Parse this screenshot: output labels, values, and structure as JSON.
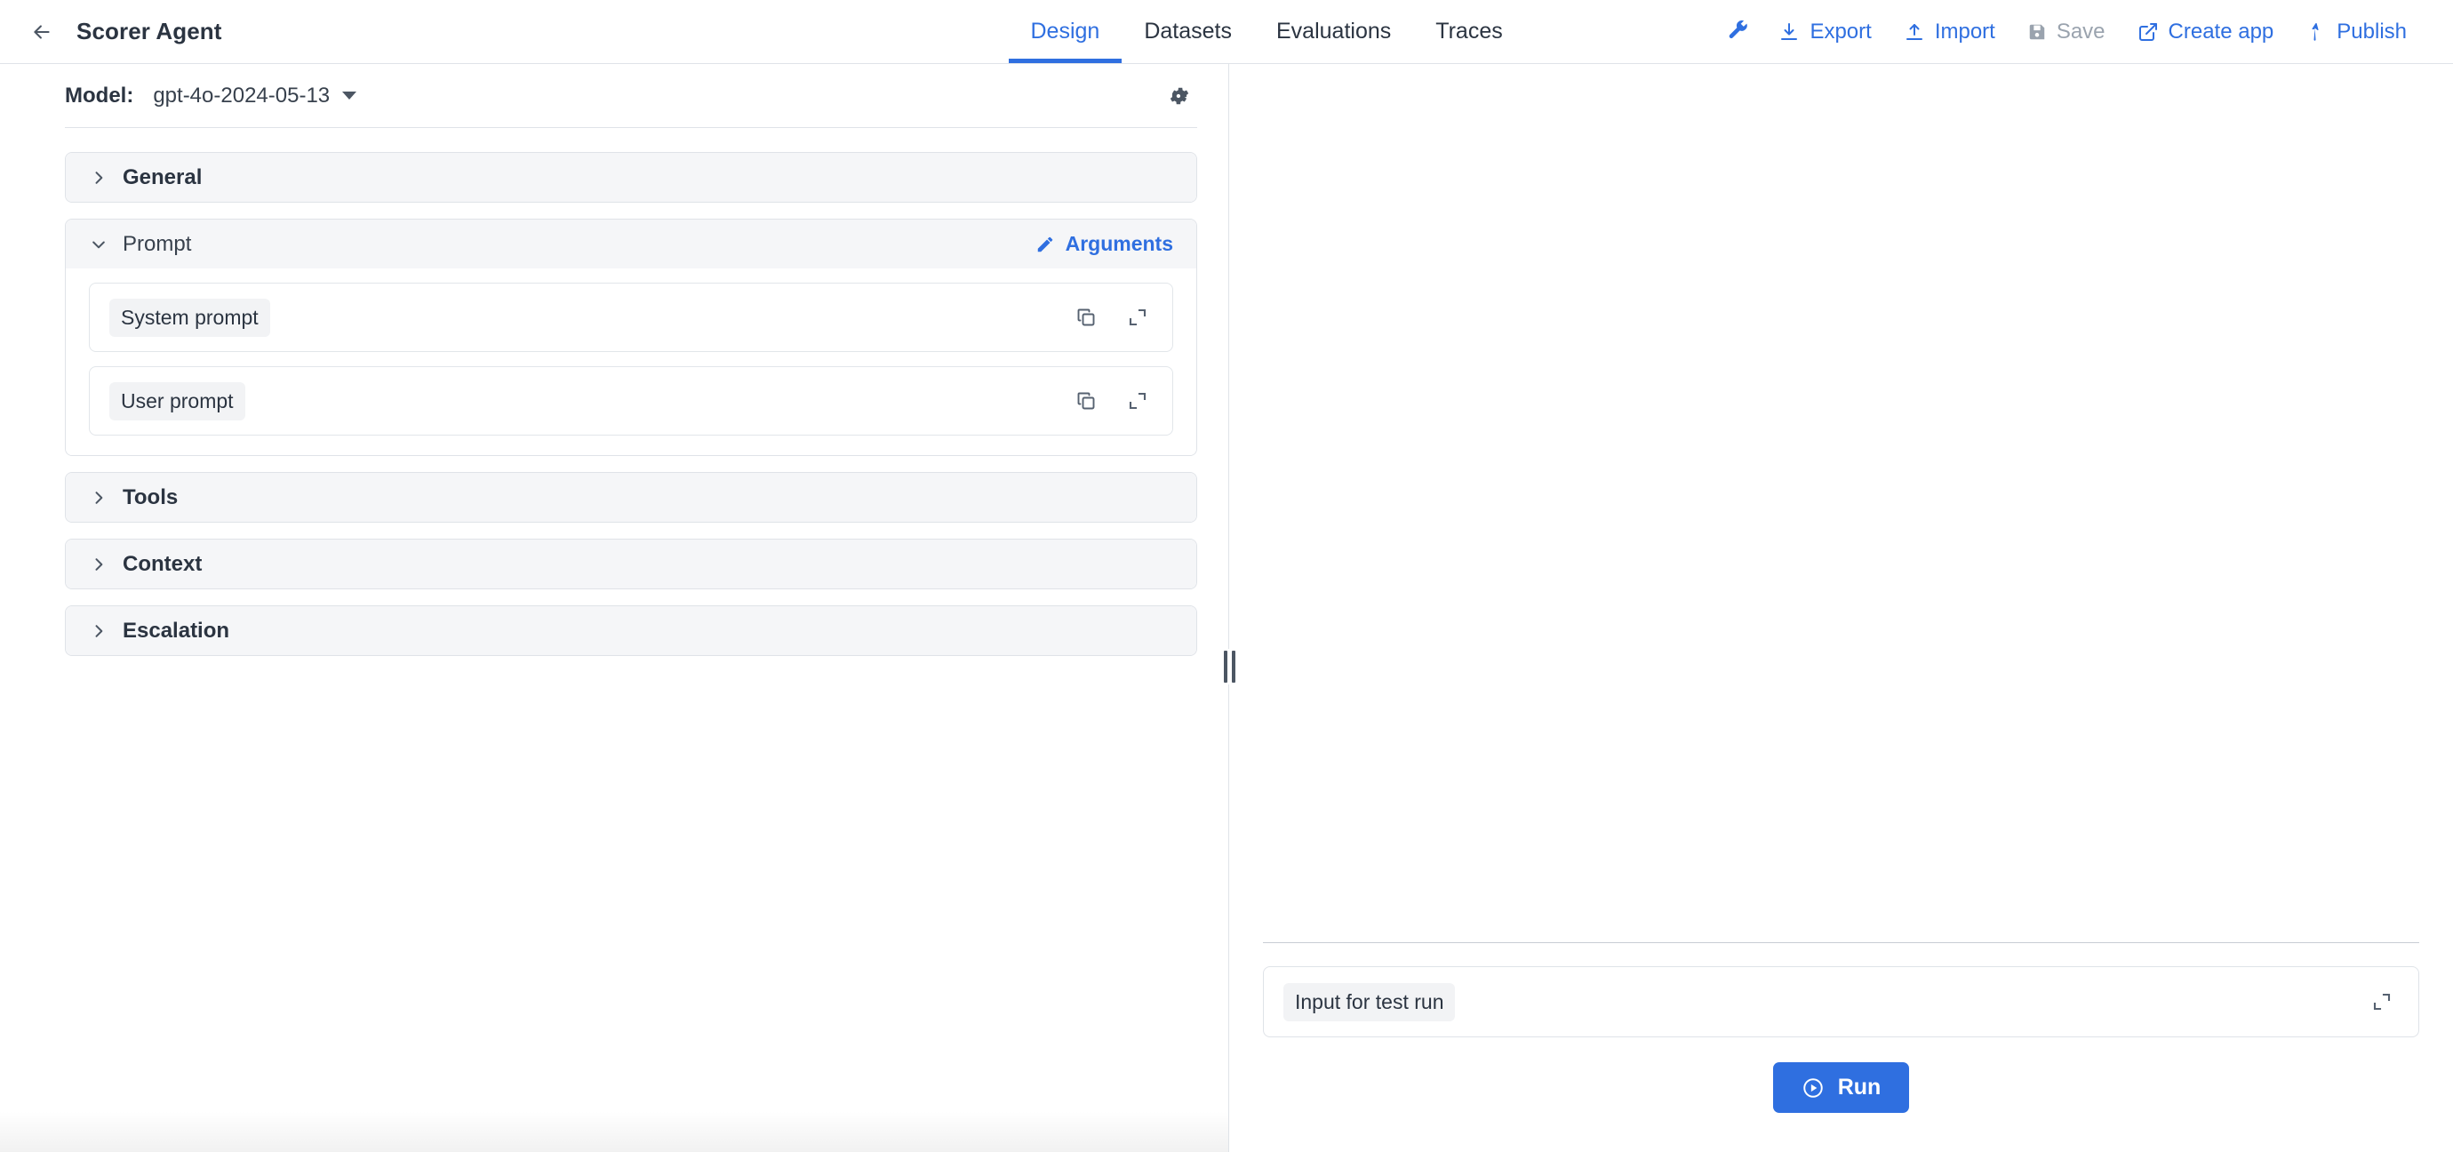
{
  "header": {
    "back_icon": "arrow-left-icon",
    "title": "Scorer Agent",
    "tabs": [
      {
        "label": "Design",
        "active": true
      },
      {
        "label": "Datasets",
        "active": false
      },
      {
        "label": "Evaluations",
        "active": false
      },
      {
        "label": "Traces",
        "active": false
      }
    ],
    "toolbar": [
      {
        "label": "",
        "icon": "wrench-icon",
        "disabled": false
      },
      {
        "label": "Export",
        "icon": "download-icon",
        "disabled": false
      },
      {
        "label": "Import",
        "icon": "upload-icon",
        "disabled": false
      },
      {
        "label": "Save",
        "icon": "save-disk-icon",
        "disabled": true
      },
      {
        "label": "Create app",
        "icon": "external-link-icon",
        "disabled": false
      },
      {
        "label": "Publish",
        "icon": "publish-arrow-icon",
        "disabled": false
      }
    ]
  },
  "model": {
    "label": "Model:",
    "value": "gpt-4o-2024-05-13",
    "settings_icon": "gear-icon"
  },
  "sections": [
    {
      "title": "General",
      "open": false
    },
    {
      "title": "Prompt",
      "open": true
    },
    {
      "title": "Tools",
      "open": false
    },
    {
      "title": "Context",
      "open": false
    },
    {
      "title": "Escalation",
      "open": false
    }
  ],
  "prompt": {
    "title": "Prompt",
    "arguments_label": "Arguments",
    "arguments_icon": "pencil-icon",
    "rows": [
      {
        "label": "System prompt",
        "copy_icon": "copy-icon",
        "expand_icon": "expand-icon"
      },
      {
        "label": "User prompt",
        "copy_icon": "copy-icon",
        "expand_icon": "expand-icon"
      }
    ]
  },
  "run_panel": {
    "input_label": "Input for test run",
    "input_expand_icon": "expand-icon",
    "run_label": "Run",
    "run_icon": "play-circle-icon"
  },
  "colors": {
    "accent": "#2f6fe0",
    "text": "#2b3441",
    "muted": "#9aa3ae",
    "border": "#dfe3e8",
    "panel": "#f5f6f8"
  }
}
